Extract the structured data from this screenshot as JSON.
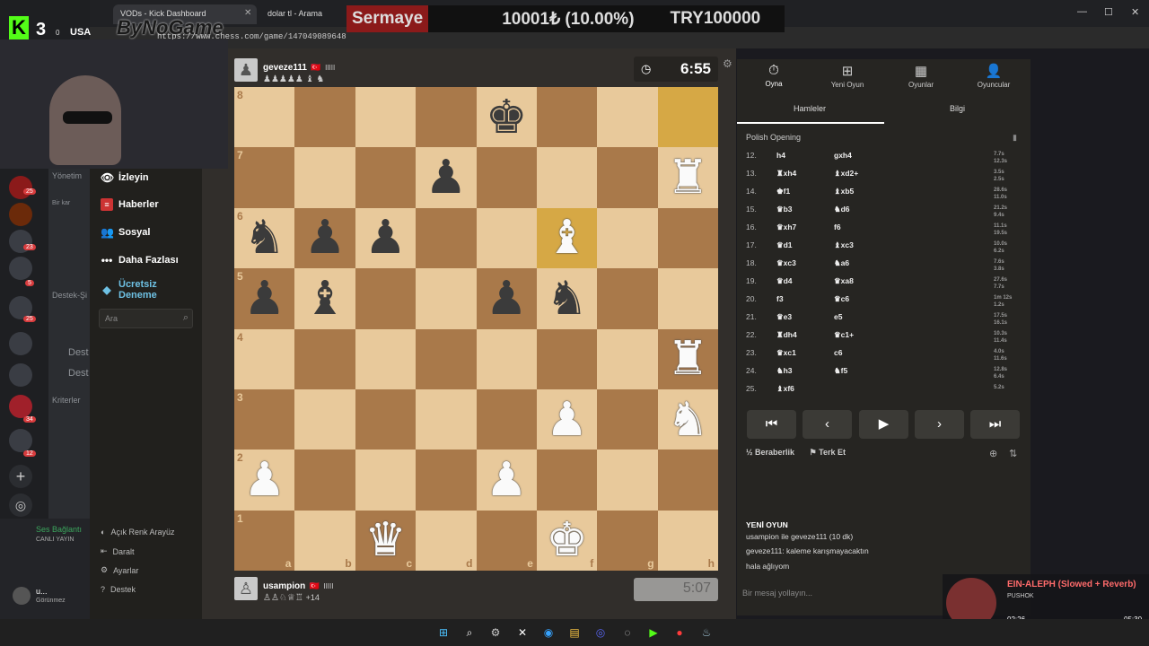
{
  "browser": {
    "tabs": [
      {
        "label": "VODs - Kick Dashboard"
      },
      {
        "label": "dolar tl - Arama"
      }
    ],
    "url": "https://www.chess.com/game/147049089648"
  },
  "overlay": {
    "label": "Sermaye",
    "value": "10001₺ (10.00%)",
    "target": "TRY100000"
  },
  "watermark": "ByNoGame",
  "kick": {
    "k": "K",
    "num": "3",
    "zero": "0",
    "name": "USA"
  },
  "discord": {
    "labels": {
      "yonetim": "Yönetim",
      "destek": "Destek-Şi",
      "kriterler": "Kriterler",
      "sesbaglanti": "Ses Bağlantı",
      "canli": "CANLI YAYIN",
      "user": "u...",
      "status": "Görünmez",
      "desteh1": "Dest",
      "desteh2": "Dest",
      "birkar": "Bir kar"
    },
    "badges": [
      "25",
      "23",
      "5",
      "25",
      "34",
      "12"
    ]
  },
  "sidebar": {
    "items": [
      {
        "label": "İzleyin"
      },
      {
        "label": "Haberler"
      },
      {
        "label": "Sosyal"
      },
      {
        "label": "Daha Fazlası"
      },
      {
        "label": "Ücretsiz Deneme"
      }
    ],
    "search_placeholder": "Ara",
    "bottom": [
      {
        "label": "Açık Renk Arayüz"
      },
      {
        "label": "Daralt"
      },
      {
        "label": "Ayarlar"
      },
      {
        "label": "Destek"
      }
    ]
  },
  "top_player": {
    "name": "geveze111",
    "flag": "🇹🇷",
    "bars": "IIIII",
    "captured": "♟♟♟♟♟ ♝ ♞"
  },
  "bottom_player": {
    "name": "usampion",
    "flag": "🇹🇷",
    "bars": "IIIII",
    "captured": "♙♙♘♕♖",
    "advantage": "+14"
  },
  "clocks": {
    "top": "6:55",
    "bottom": "5:07"
  },
  "board": {
    "ranks": [
      "8",
      "7",
      "6",
      "5",
      "4",
      "3",
      "2",
      "1"
    ],
    "files": [
      "a",
      "b",
      "c",
      "d",
      "e",
      "f",
      "g",
      "h"
    ],
    "position": [
      [
        "",
        "",
        "",
        "",
        "bk",
        "",
        "",
        ""
      ],
      [
        "",
        "",
        "",
        "bp",
        "",
        "",
        "",
        "wr"
      ],
      [
        "bn",
        "bp",
        "bp",
        "",
        "",
        "wb",
        "",
        ""
      ],
      [
        "bp",
        "bb",
        "",
        "",
        "bp",
        "bn",
        "",
        ""
      ],
      [
        "",
        "",
        "",
        "",
        "",
        "",
        "",
        "wr"
      ],
      [
        "",
        "",
        "",
        "",
        "",
        "wp",
        "",
        "wn"
      ],
      [
        "wp",
        "",
        "",
        "",
        "wp",
        "",
        "",
        ""
      ],
      [
        "",
        "",
        "wq",
        "",
        "",
        "wk",
        "",
        ""
      ]
    ],
    "highlights": [
      "h8",
      "f6"
    ]
  },
  "right_panel": {
    "tabs": [
      {
        "label": "Oyna",
        "icon": "stopwatch-icon"
      },
      {
        "label": "Yeni Oyun",
        "icon": "plus-icon"
      },
      {
        "label": "Oyunlar",
        "icon": "board-icon"
      },
      {
        "label": "Oyuncular",
        "icon": "players-icon"
      }
    ],
    "subtabs": [
      "Hamleler",
      "Bilgi"
    ],
    "opening": "Polish Opening",
    "moves": [
      {
        "n": "12.",
        "w": "h4",
        "b": "gxh4",
        "tw": "7.7s",
        "tb": "12.3s"
      },
      {
        "n": "13.",
        "w": "♜xh4",
        "b": "♝xd2+",
        "tw": "3.5s",
        "tb": "2.5s"
      },
      {
        "n": "14.",
        "w": "♚f1",
        "b": "♝xb5",
        "tw": "28.6s",
        "tb": "11.0s"
      },
      {
        "n": "15.",
        "w": "♛b3",
        "b": "♞d6",
        "tw": "21.2s",
        "tb": "9.4s"
      },
      {
        "n": "16.",
        "w": "♛xh7",
        "b": "f6",
        "tw": "11.1s",
        "tb": "19.5s"
      },
      {
        "n": "17.",
        "w": "♛d1",
        "b": "♝xc3",
        "tw": "10.0s",
        "tb": "6.2s"
      },
      {
        "n": "18.",
        "w": "♛xc3",
        "b": "♞a6",
        "tw": "7.6s",
        "tb": "3.8s"
      },
      {
        "n": "19.",
        "w": "♛d4",
        "b": "♛xa8",
        "tw": "27.6s",
        "tb": "7.7s"
      },
      {
        "n": "20.",
        "w": "f3",
        "b": "♛c6",
        "tw": "1m 12s",
        "tb": "1.2s"
      },
      {
        "n": "21.",
        "w": "♛e3",
        "b": "e5",
        "tw": "17.5s",
        "tb": "16.1s"
      },
      {
        "n": "22.",
        "w": "♜dh4",
        "b": "♛c1+",
        "tw": "10.3s",
        "tb": "11.4s"
      },
      {
        "n": "23.",
        "w": "♛xc1",
        "b": "c6",
        "tw": "4.0s",
        "tb": "11.6s"
      },
      {
        "n": "24.",
        "w": "♞h3",
        "b": "♞f5",
        "tw": "12.8s",
        "tb": "6.4s"
      },
      {
        "n": "25.",
        "w": "♝xf6",
        "b": "",
        "tw": "5.2s",
        "tb": ""
      }
    ],
    "nav": [
      "⏮",
      "‹",
      "▶",
      "›",
      "⏭"
    ],
    "draw": "Beraberlik",
    "resign": "Terk Et",
    "chat_title": "YENİ OYUN",
    "chat": [
      "usampion ile geveze111 (10 dk)",
      "geveze111: kaleme karışmayacaktın",
      "hala ağlıyom"
    ],
    "message_placeholder": "Bir mesaj yollayın..."
  },
  "music": {
    "title": "EIN-ALEPH (Slowed + Reverb)",
    "artist": "PUSHOK",
    "elapsed": "02:26",
    "total": "05:30"
  }
}
